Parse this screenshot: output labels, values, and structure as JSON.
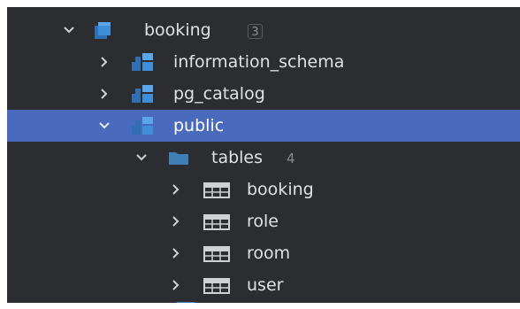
{
  "tree": {
    "db": {
      "label": "booking",
      "badge": "3",
      "icon": "database-icon",
      "expanded": true
    },
    "schemas": [
      {
        "label": "information_schema",
        "icon": "schema-icon",
        "expanded": false,
        "selected": false
      },
      {
        "label": "pg_catalog",
        "icon": "schema-icon",
        "expanded": false,
        "selected": false
      },
      {
        "label": "public",
        "icon": "schema-icon",
        "expanded": true,
        "selected": true
      }
    ],
    "tables_folder": {
      "label": "tables",
      "count": "4",
      "icon": "folder-icon",
      "expanded": true
    },
    "tables": [
      {
        "label": "booking",
        "icon": "table-icon"
      },
      {
        "label": "role",
        "icon": "table-icon"
      },
      {
        "label": "room",
        "icon": "table-icon"
      },
      {
        "label": "user",
        "icon": "table-icon"
      }
    ]
  },
  "colors": {
    "background": "#2b2d30",
    "selection": "#4a6bbd",
    "text": "#dfe1e5",
    "icon_blue": "#3f8fd8",
    "folder_blue": "#3f7fb7",
    "chevron": "#cfd1d4"
  }
}
